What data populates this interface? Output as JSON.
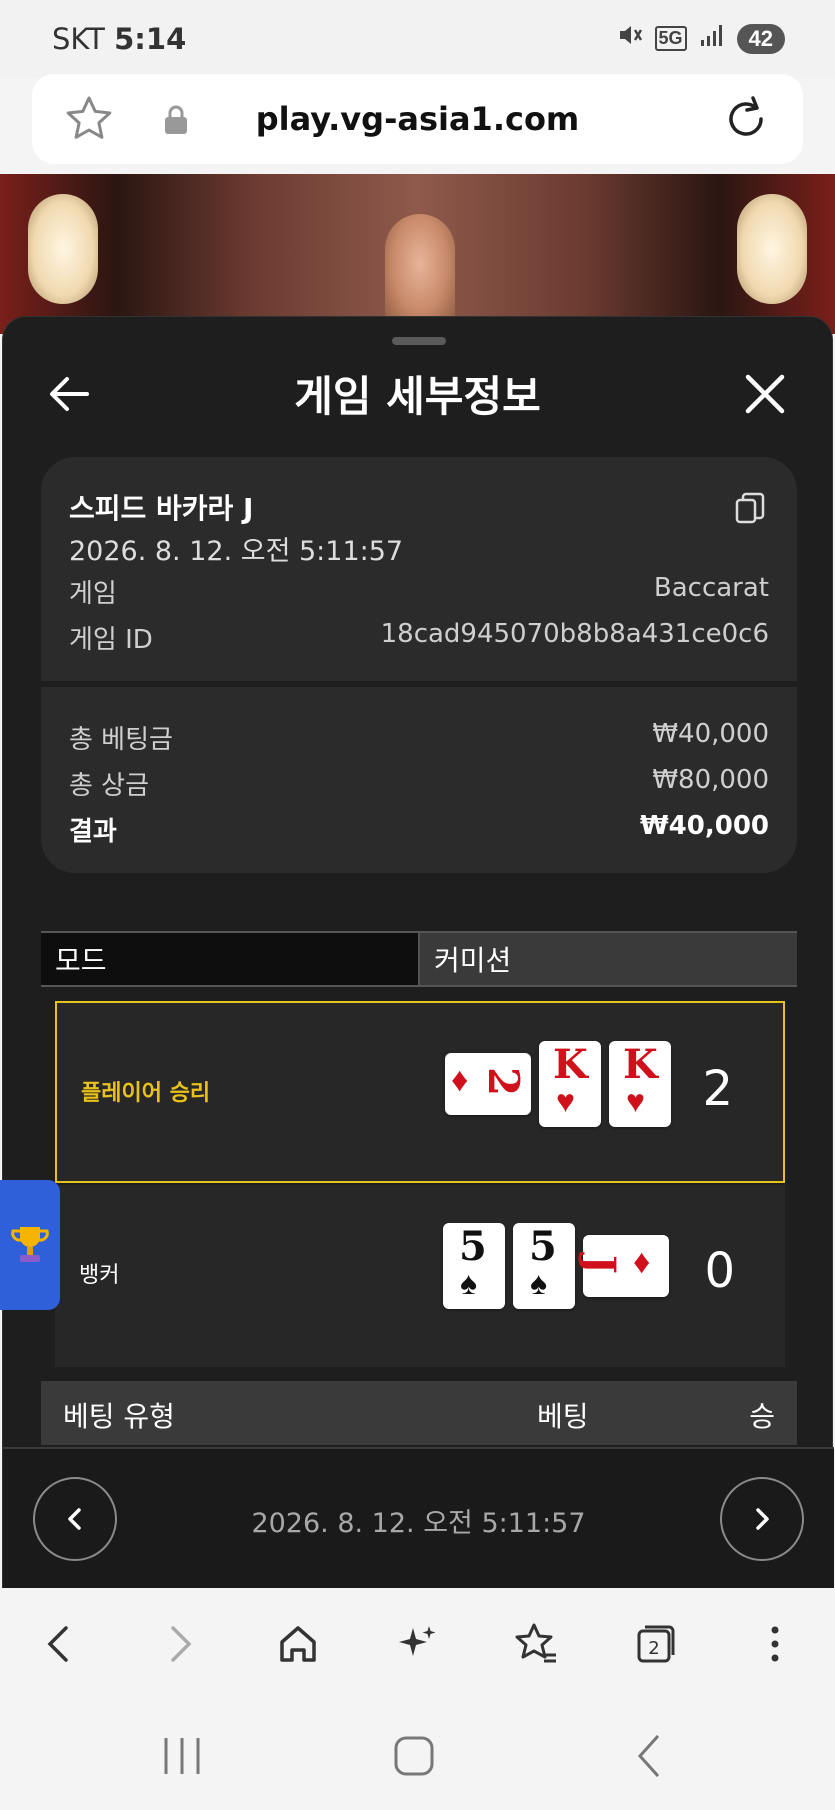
{
  "status": {
    "carrier": "SKT",
    "time": "5:14",
    "network": "5G",
    "battery": "42"
  },
  "browser": {
    "url": "play.vg-asia1.com"
  },
  "sheet": {
    "title": "게임 세부정보",
    "game_name": "스피드 바카라 J",
    "game_datetime": "2026. 8. 12. 오전 5:11:57",
    "details": [
      {
        "label": "게임",
        "value": "Baccarat"
      },
      {
        "label": "게임 ID",
        "value": "18cad945070b8b8a431ce0c6"
      }
    ],
    "totals": [
      {
        "label": "총 베팅금",
        "value": "₩40,000"
      },
      {
        "label": "총 상금",
        "value": "₩80,000"
      },
      {
        "label": "결과",
        "value": "₩40,000"
      }
    ],
    "tabs": [
      {
        "label": "모드"
      },
      {
        "label": "커미션"
      }
    ],
    "player": {
      "label": "플레이어 승리",
      "score": "2",
      "cards": [
        {
          "rank": "2",
          "suit": "♦",
          "color": "#d0101a",
          "orientation": "sideways"
        },
        {
          "rank": "K",
          "suit": "♥",
          "color": "#d0101a",
          "orientation": "upright"
        },
        {
          "rank": "K",
          "suit": "♥",
          "color": "#d0101a",
          "orientation": "upright"
        }
      ]
    },
    "banker": {
      "label": "뱅커",
      "score": "0",
      "cards": [
        {
          "rank": "5",
          "suit": "♠",
          "color": "#111111",
          "orientation": "upright"
        },
        {
          "rank": "5",
          "suit": "♠",
          "color": "#111111",
          "orientation": "upright"
        },
        {
          "rank": "J",
          "suit": "♦",
          "color": "#d0101a",
          "orientation": "sideways"
        }
      ]
    },
    "bet_table": {
      "col_type": "베팅 유형",
      "col_bet": "베팅",
      "col_win": "승"
    },
    "footer_date": "2026. 8. 12. 오전 5:11:57"
  },
  "colors": {
    "win_highlight": "#e8c21a",
    "sheet_bg": "#1e1e1e",
    "trophy_tab": "#2f5fd9"
  }
}
